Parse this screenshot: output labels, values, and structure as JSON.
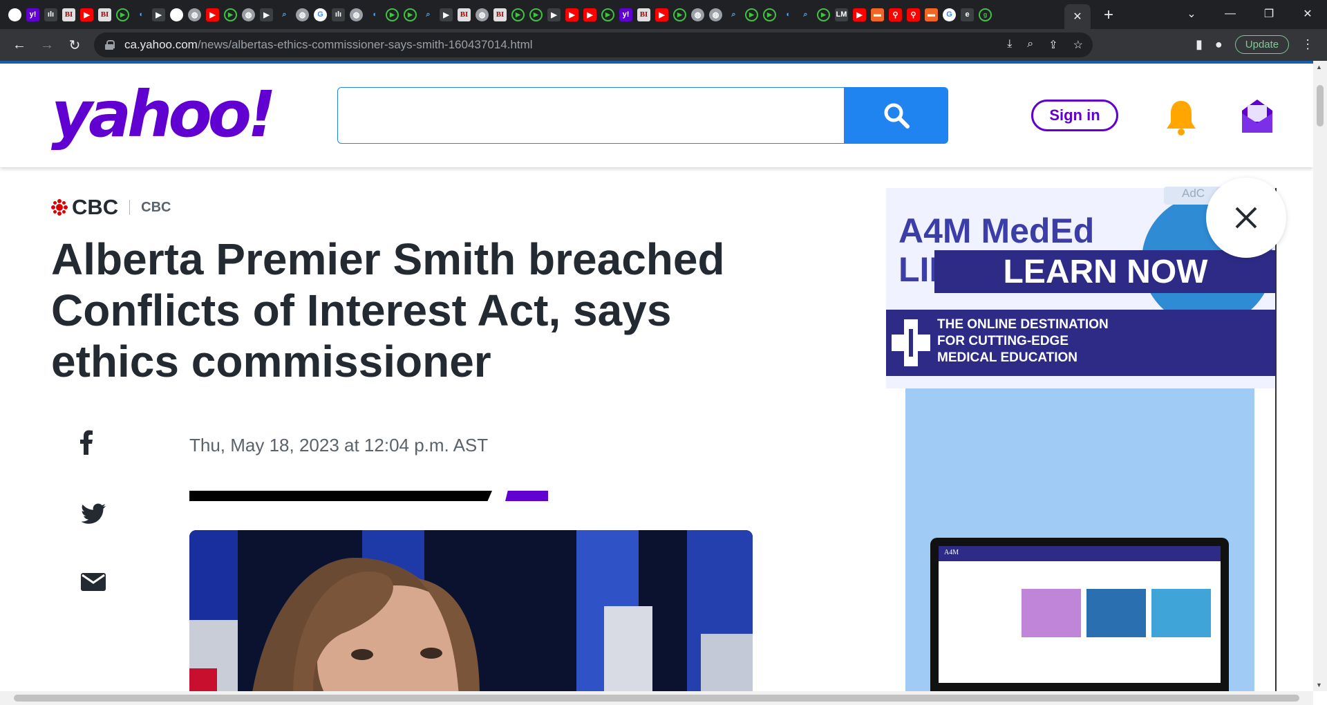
{
  "browser": {
    "tabs": {
      "favicons": [
        "chrome-icon",
        "yahoo-icon",
        "music-icon",
        "bi-icon",
        "youtube-icon",
        "bi-icon",
        "play-icon",
        "shield-icon",
        "arrow-icon",
        "qr-icon",
        "globe-icon",
        "youtube-icon",
        "play-icon",
        "globe-icon",
        "arrow-icon",
        "search-icon",
        "web-icon",
        "google-icon",
        "music-icon",
        "globe-icon",
        "shield-icon",
        "play-icon",
        "play-icon",
        "search-icon",
        "arrow-icon",
        "bi-icon",
        "globe-icon",
        "bi-icon",
        "play-icon",
        "play-icon",
        "arrow-icon",
        "youtube-icon",
        "youtube-icon",
        "play-icon",
        "yahoo-icon",
        "bi-icon",
        "youtube-icon",
        "play-icon",
        "globe-icon",
        "globe-icon",
        "search-icon",
        "play-icon",
        "play-icon",
        "shield-icon",
        "search-icon",
        "play-icon",
        "lm-icon",
        "youtube-icon",
        "book-icon",
        "pin-icon",
        "pin-icon",
        "book-icon",
        "google-icon",
        "e-icon",
        "g-icon"
      ],
      "active_close": "✕",
      "new_tab": "+"
    },
    "url_host": "ca.yahoo.com",
    "url_path": "/news/albertas-ethics-commissioner-says-smith-160437014.html",
    "update_label": "Update"
  },
  "yahoo": {
    "logo": "yahoo!",
    "signin_label": "Sign in",
    "search_placeholder": ""
  },
  "article": {
    "source_logo": "CBC",
    "provider": "CBC",
    "headline": "Alberta Premier Smith breached Conflicts of Interest Act, says ethics commissioner",
    "date": "Thu, May 18, 2023 at 12:04 p.m. AST"
  },
  "ad": {
    "choices_label": "AdC",
    "title": "A4M MedEd LIBRARY",
    "band_text": "THE ONLINE DESTINATION\nFOR CUTTING-EDGE\nMEDICAL EDUCATION",
    "cta": "LEARN NOW",
    "laptop_logo": "A4M"
  },
  "colors": {
    "yahoo_purple": "#6001d2",
    "search_blue": "#1f84f0",
    "bell_yellow": "#ffa700"
  }
}
